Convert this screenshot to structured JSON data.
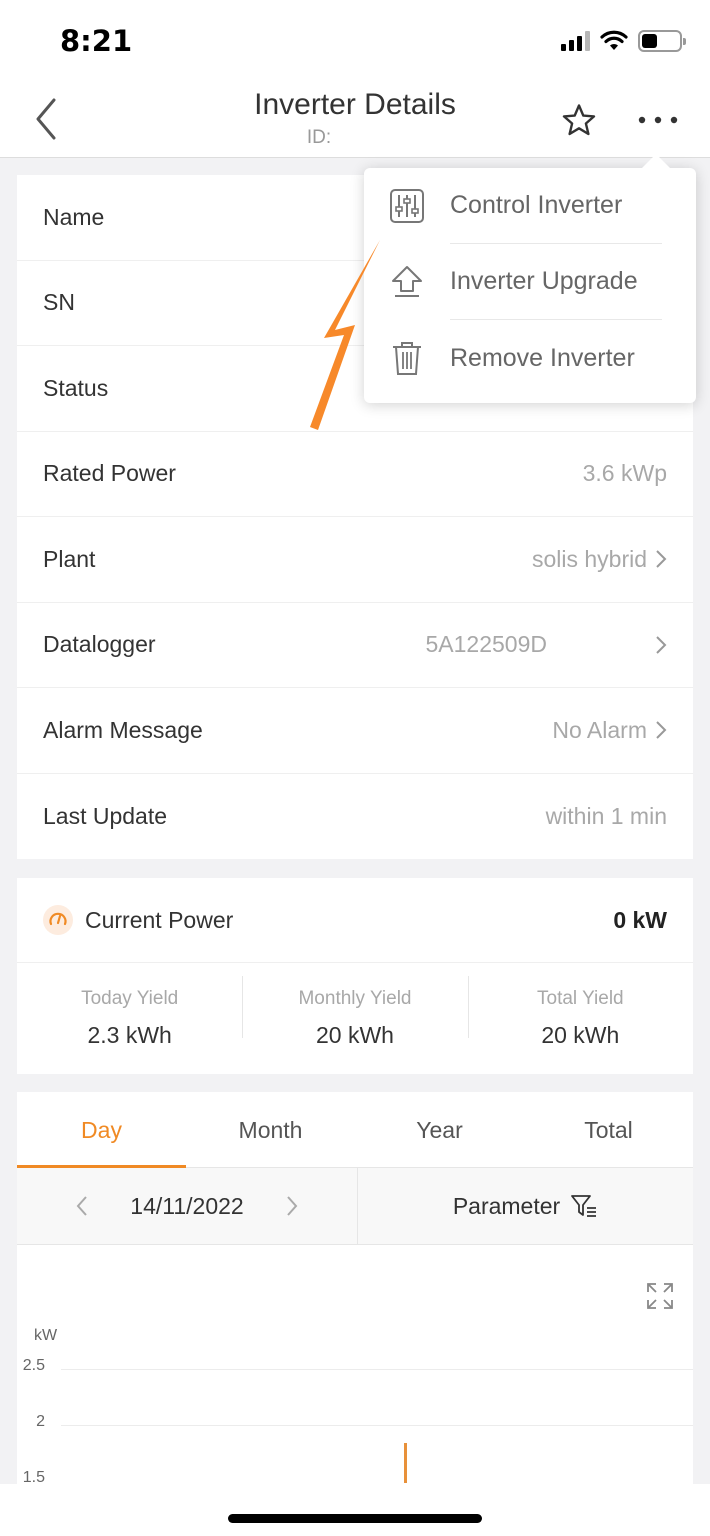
{
  "status_bar": {
    "time": "8:21"
  },
  "nav": {
    "title": "Inverter Details",
    "subtitle": "ID:"
  },
  "menu": {
    "items": [
      {
        "label": "Control Inverter",
        "icon": "sliders-icon"
      },
      {
        "label": "Inverter Upgrade",
        "icon": "upload-arrow-icon"
      },
      {
        "label": "Remove Inverter",
        "icon": "trash-icon"
      }
    ]
  },
  "info_rows": [
    {
      "label": "Name",
      "value": ""
    },
    {
      "label": "SN",
      "value": ""
    },
    {
      "label": "Status",
      "value": ""
    },
    {
      "label": "Rated Power",
      "value": "3.6 kWp"
    },
    {
      "label": "Plant",
      "value": "solis hybrid"
    },
    {
      "label": "Datalogger",
      "value": "5A122509D"
    },
    {
      "label": "Alarm Message",
      "value": "No Alarm"
    },
    {
      "label": "Last Update",
      "value": "within 1 min"
    }
  ],
  "power": {
    "label": "Current Power",
    "value": "0 kW",
    "yields": [
      {
        "label": "Today Yield",
        "value": "2.3 kWh"
      },
      {
        "label": "Monthly Yield",
        "value": "20 kWh"
      },
      {
        "label": "Total Yield",
        "value": "20 kWh"
      }
    ]
  },
  "tabs": [
    "Day",
    "Month",
    "Year",
    "Total"
  ],
  "active_tab": "Day",
  "date": "14/11/2022",
  "parameter_label": "Parameter",
  "chart": {
    "unit": "kW",
    "ticks": [
      "2.5",
      "2",
      "1.5"
    ]
  },
  "colors": {
    "accent": "#f08a24",
    "annotation_arrow": "#f7892a"
  }
}
